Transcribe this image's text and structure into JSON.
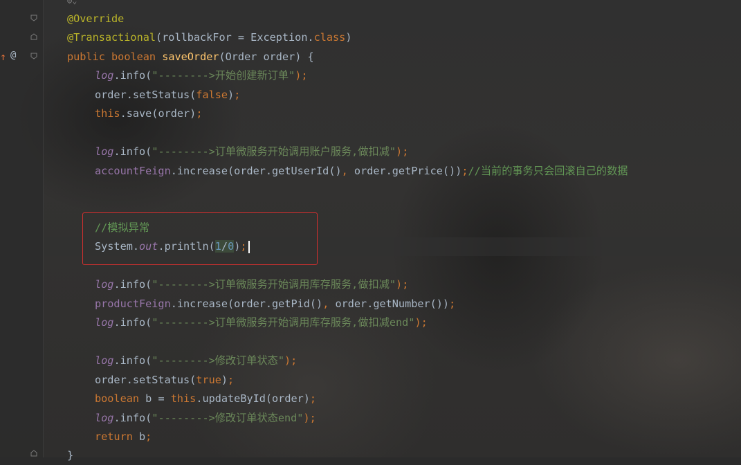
{
  "editor": {
    "annotations": {
      "override": "@Override",
      "transactional": "@Transactional",
      "transactional_args_open": "(rollbackFor = Exception.",
      "transactional_class": "class",
      "transactional_close": ")"
    },
    "signature": {
      "public": "public",
      "boolean": "boolean",
      "method": "saveOrder",
      "params": "(Order order) {"
    },
    "log": "log",
    "info": ".info(",
    "close_paren_semi": ");",
    "strings": {
      "start": "\"-------->开始创建新订单\"",
      "account": "\"-------->订单微服务开始调用账户服务,做扣减\"",
      "product": "\"-------->订单微服务开始调用库存服务,做扣减\"",
      "product_end": "\"-------->订单微服务开始调用库存服务,做扣减end\"",
      "update": "\"-------->修改订单状态\"",
      "update_end": "\"-------->修改订单状态end\""
    },
    "lines": {
      "set_status_false_a": "order.setStatus(",
      "false": "false",
      "this": "this",
      "save": ".save(order)",
      "semi": ";",
      "account_feign": "accountFeign",
      "account_call": ".increase(order.getUserId()",
      "comma": ",",
      "account_call2": " order.getPrice())",
      "account_comment": "//当前的事务只会回滚自己的数据",
      "comment_exception": "//模拟异常",
      "system": "System.",
      "out": "out",
      "println": ".println(",
      "one": "1",
      "slash": "/",
      "zero": "0",
      "close": ")",
      "product_feign": "productFeign",
      "product_call": ".increase(order.getPid()",
      "product_call2": " order.getNumber())",
      "set_status_true_a": "order.setStatus(",
      "true": "true",
      "boolean_b": "boolean",
      "b_assign": " b = ",
      "update_call": ".updateById(order)",
      "return": "return",
      "return_b": " b",
      "closing_brace": "}"
    }
  },
  "gutter": {
    "override_icon": "override-arrow-icon",
    "at_icon": "@"
  },
  "colors": {
    "keyword": "#cc7832",
    "string": "#6a8759",
    "annotation": "#bbb529",
    "method_decl": "#ffc66d",
    "field": "#9876aa",
    "highlight_box": "#d32f2f"
  }
}
